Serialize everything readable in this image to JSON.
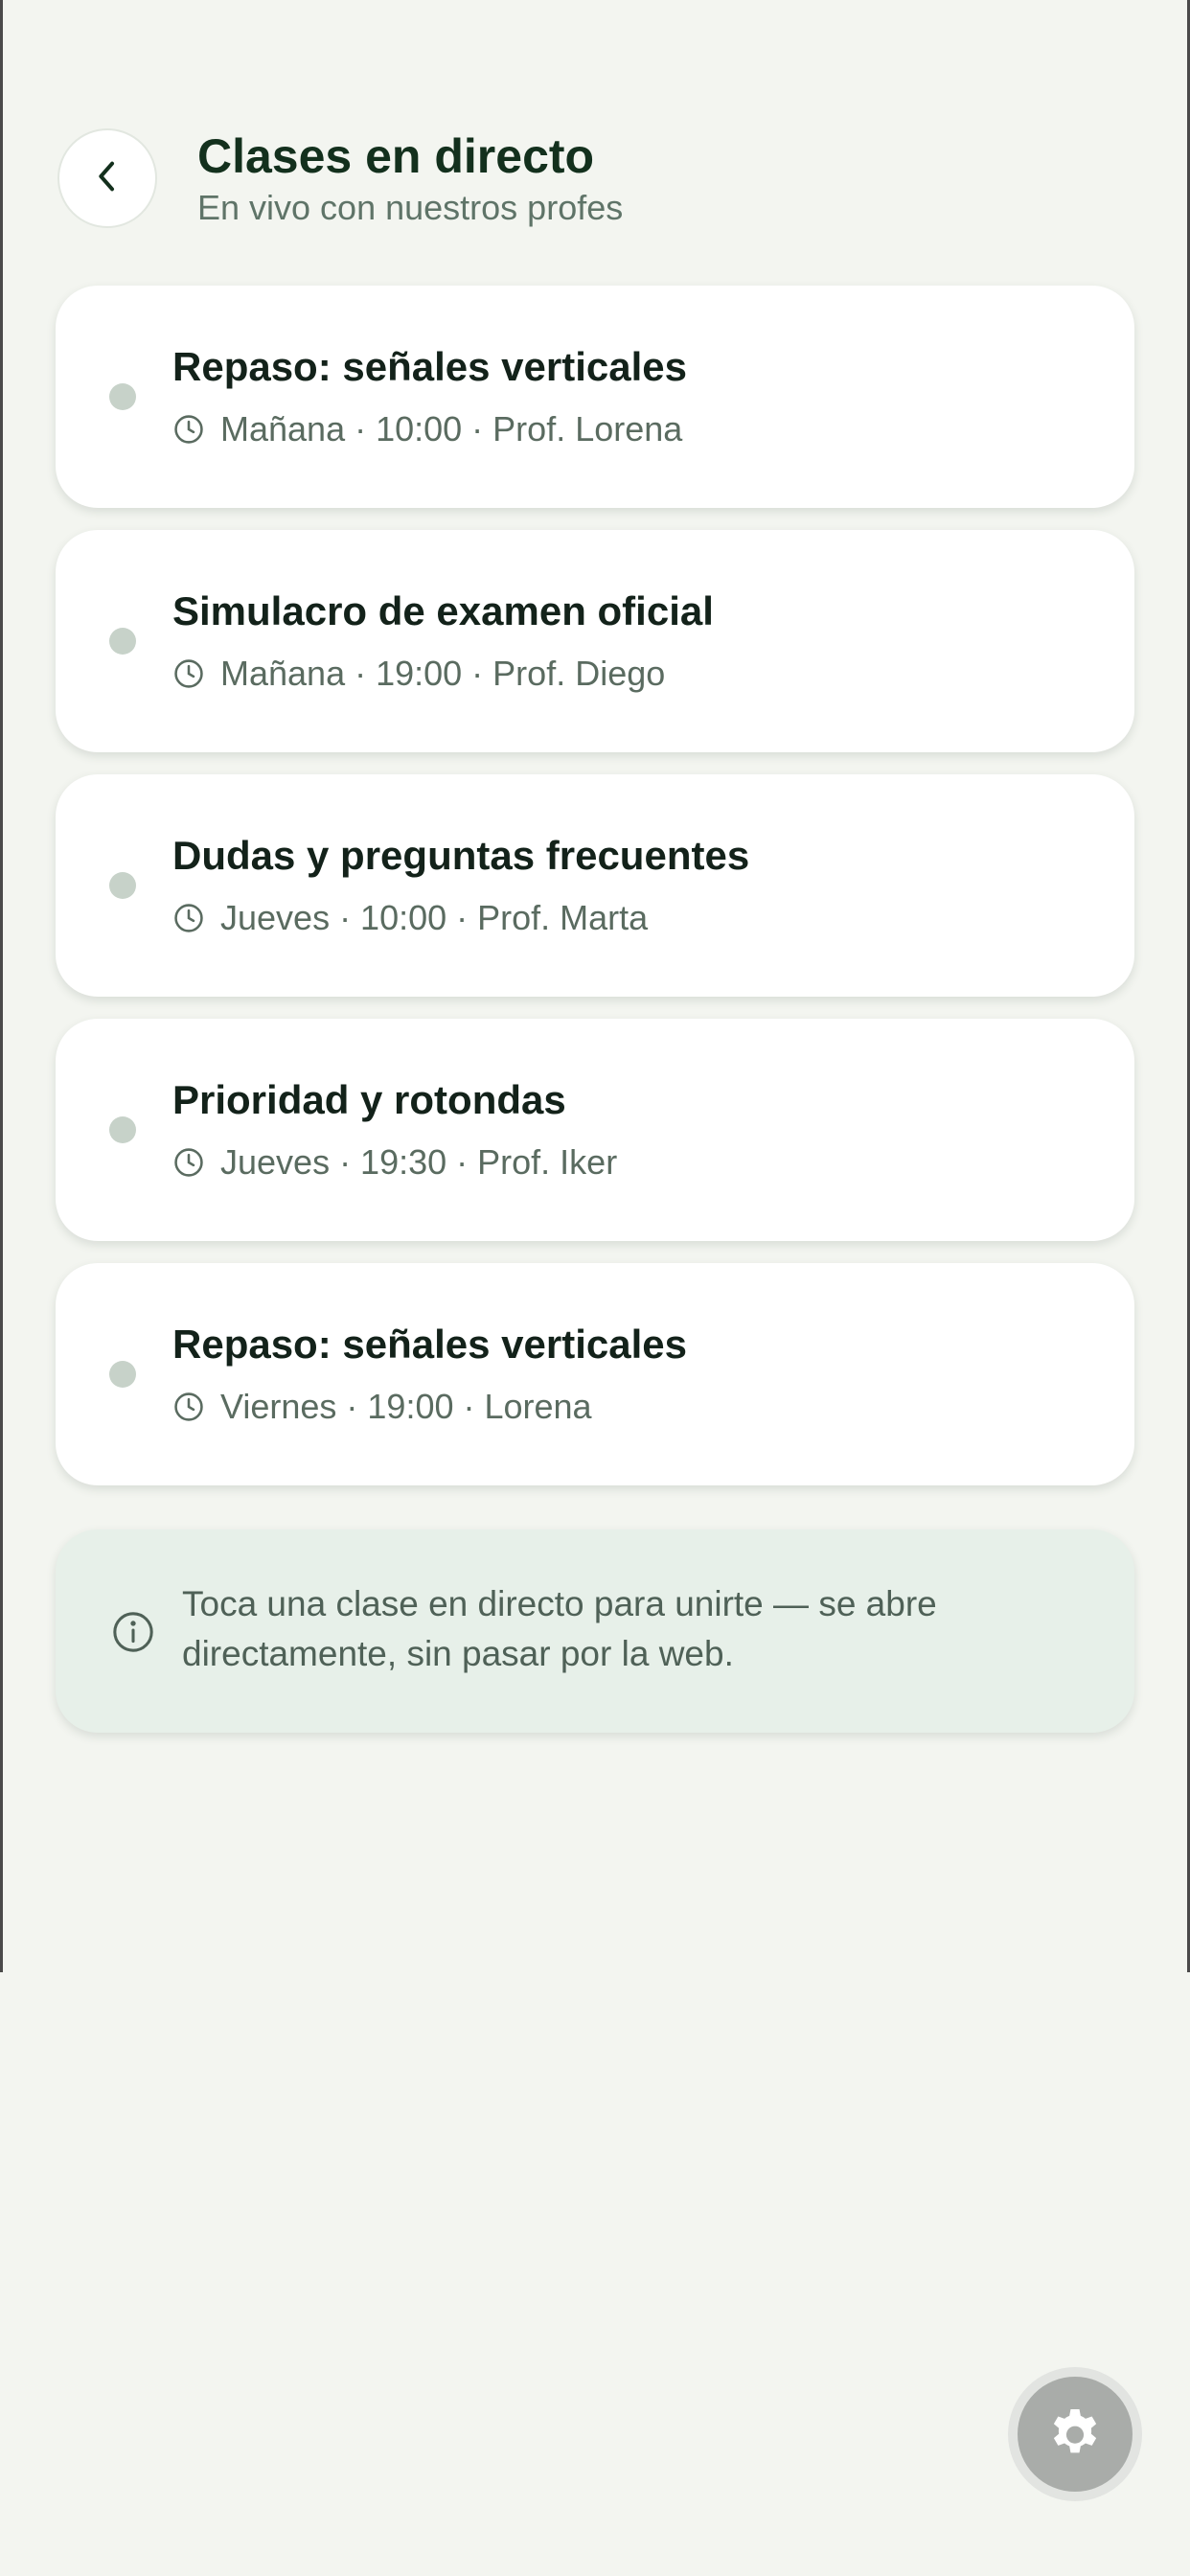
{
  "header": {
    "back_icon": "chevron-left-icon",
    "title": "Clases en directo",
    "subtitle": "En vivo con nuestros profes"
  },
  "classes": [
    {
      "title": "Repaso: señales verticales",
      "meta": "Mañana · 10:00 · Prof. Lorena"
    },
    {
      "title": "Simulacro de examen oficial",
      "meta": "Mañana · 19:00 · Prof. Diego"
    },
    {
      "title": "Dudas y preguntas frecuentes",
      "meta": "Jueves · 10:00 · Prof. Marta"
    },
    {
      "title": "Prioridad y rotondas",
      "meta": "Jueves · 19:30 · Prof. Iker"
    },
    {
      "title": "Repaso: señales verticales",
      "meta": "Viernes · 19:00 · Lorena"
    }
  ],
  "info": {
    "icon": "info-icon",
    "text": "Toca una clase en directo para unirte — se abre directamente, sin pasar por la web."
  },
  "fab": {
    "icon": "gear-icon"
  },
  "colors": {
    "background": "#f3f5f0",
    "title": "#13301d",
    "subtitle": "#5f7468",
    "status_dot": "#c7d2c9",
    "info_bg": "#e7f0e9"
  }
}
